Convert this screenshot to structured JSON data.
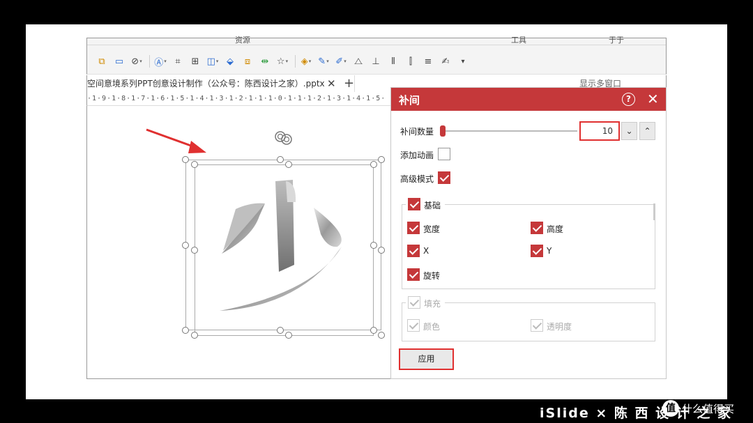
{
  "ribbon": {
    "group_labels": [
      "资源",
      "工具",
      "于于"
    ]
  },
  "document_tab": {
    "title": "空间意境系列PPT创意设计制作（公众号：陈西设计之家）.pptx",
    "close": "✕",
    "add": "+",
    "multi_window": "显示多窗口"
  },
  "ruler": {
    "text": "·1·9·1·8·1·7·1·6·1·5·1·4·1·3·1·2·1·1·1·0·1·1·1·2·1·3·1·4·1·5·"
  },
  "dialog": {
    "title": "补间",
    "help": "?",
    "close": "✕",
    "tween_count_label": "补间数量",
    "tween_count_value": "10",
    "tween_slider_fraction": 0.0,
    "spin_down": "⌄",
    "spin_up": "⌃",
    "add_animation_label": "添加动画",
    "add_animation_checked": false,
    "advanced_mode_label": "高级模式",
    "advanced_mode_checked": true,
    "basic_group": {
      "title": "基础",
      "checked": true,
      "items": [
        {
          "label": "宽度",
          "checked": true
        },
        {
          "label": "高度",
          "checked": true
        },
        {
          "label": "X",
          "checked": true
        },
        {
          "label": "Y",
          "checked": true
        },
        {
          "label": "旋转",
          "checked": true
        }
      ]
    },
    "fill_group": {
      "title": "填充",
      "checked": true,
      "disabled": true,
      "items": [
        {
          "label": "颜色",
          "checked": true
        },
        {
          "label": "透明度",
          "checked": true
        }
      ]
    },
    "apply_label": "应用"
  },
  "canvas": {
    "shape_text": "少"
  },
  "colors": {
    "accent": "#c5383a",
    "highlight": "#e03030"
  },
  "footer": {
    "brand": "iSlide × 陈 西 设 计 之 家",
    "watermark": "什么值得买",
    "watermark_logo": "值"
  }
}
